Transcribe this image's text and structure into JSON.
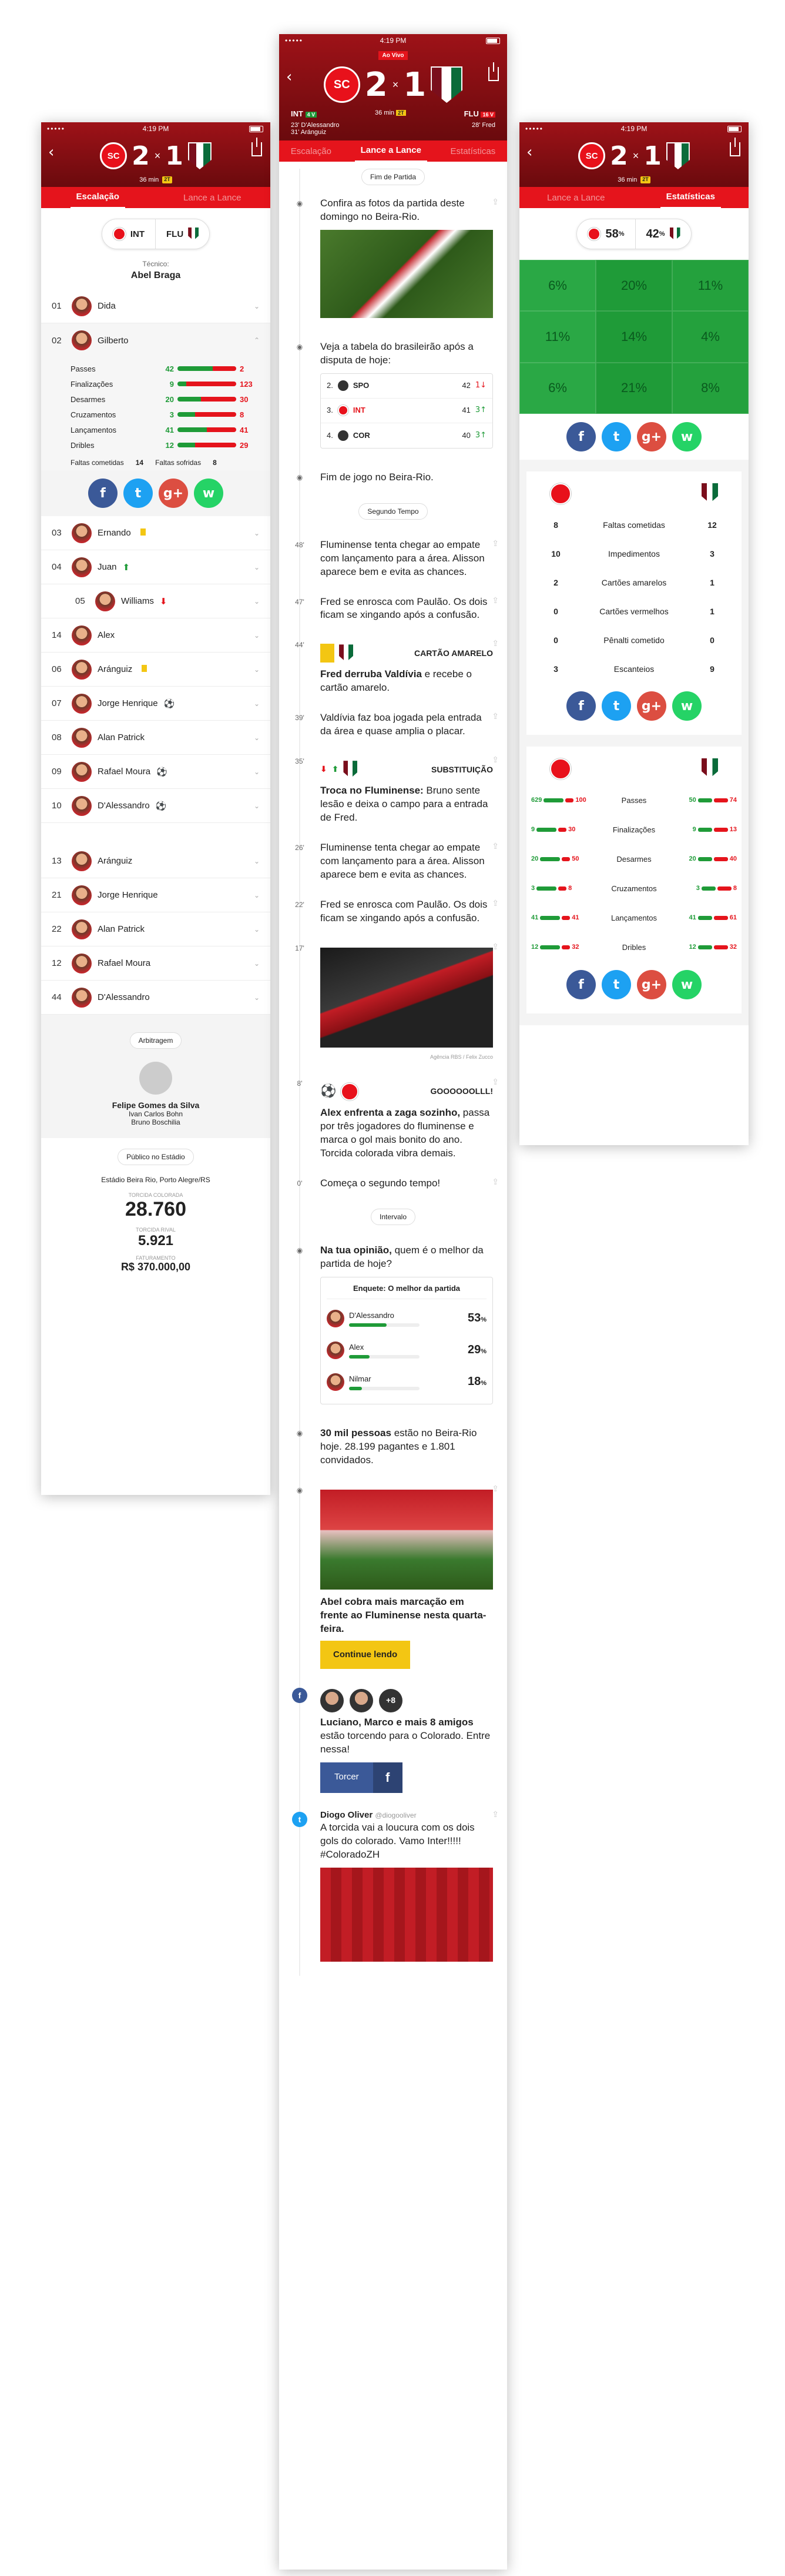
{
  "status_time": "4:19 PM",
  "carrier": "•••••",
  "score": {
    "home_abbr": "INT",
    "away_abbr": "FLU",
    "home": "2",
    "away": "1",
    "sep": "×",
    "minute": "36 min",
    "period": "2T",
    "home_badge": "4 V",
    "away_badge": "16 V",
    "live": "Ao Vivo",
    "home_goals": [
      "23' D'Alessandro",
      "31' Aránguiz"
    ],
    "away_goals": [
      "28' Fred"
    ]
  },
  "tabs": {
    "a": [
      "Escalação",
      "Lance a Lance"
    ],
    "b": [
      "Escalação",
      "Lance a Lance",
      "Estatísticas"
    ],
    "c": [
      "Lance a Lance",
      "Estatísticas"
    ]
  },
  "lineup": {
    "coach_label": "Técnico:",
    "coach": "Abel Braga",
    "team_home": "INT",
    "team_away": "FLU",
    "players": [
      {
        "n": "01",
        "name": "Dida"
      },
      {
        "n": "02",
        "name": "Gilberto"
      }
    ],
    "stats": [
      {
        "l": "Passes",
        "g": "42",
        "r": "2",
        "gp": 0.6,
        "rp": 0.4
      },
      {
        "l": "Finalizações",
        "g": "9",
        "r": "123",
        "gp": 0.15,
        "rp": 0.85
      },
      {
        "l": "Desarmes",
        "g": "20",
        "r": "30",
        "gp": 0.4,
        "rp": 0.6
      },
      {
        "l": "Cruzamentos",
        "g": "3",
        "r": "8",
        "gp": 0.3,
        "rp": 0.7
      },
      {
        "l": "Lançamentos",
        "g": "41",
        "r": "41",
        "gp": 0.5,
        "rp": 0.5
      },
      {
        "l": "Dribles",
        "g": "12",
        "r": "29",
        "gp": 0.3,
        "rp": 0.7
      }
    ],
    "faltas_cometidas": "Faltas cometidas",
    "faltas_c_val": "14",
    "faltas_sofridas": "Faltas sofridas",
    "faltas_s_val": "8",
    "players2": [
      {
        "n": "03",
        "name": "Ernando",
        "mark": "yellow"
      },
      {
        "n": "04",
        "name": "Juan",
        "mark": "up"
      },
      {
        "n": "05",
        "name": "Williams",
        "mark": "down"
      },
      {
        "n": "14",
        "name": "Alex",
        "mark": ""
      },
      {
        "n": "06",
        "name": "Aránguiz",
        "mark": "yellow"
      },
      {
        "n": "07",
        "name": "Jorge Henrique",
        "mark": "ball"
      },
      {
        "n": "08",
        "name": "Alan Patrick",
        "mark": ""
      },
      {
        "n": "09",
        "name": "Rafael Moura",
        "mark": "ball"
      },
      {
        "n": "10",
        "name": "D'Alessandro",
        "mark": "ball"
      }
    ],
    "bench": [
      {
        "n": "13",
        "name": "Aránguiz"
      },
      {
        "n": "21",
        "name": "Jorge Henrique"
      },
      {
        "n": "22",
        "name": "Alan Patrick"
      },
      {
        "n": "12",
        "name": "Rafael Moura"
      },
      {
        "n": "44",
        "name": "D'Alessandro"
      }
    ],
    "arb_label": "Arbitragem",
    "referee": "Felipe Gomes da Silva",
    "assist1": "Ivan Carlos Bohn",
    "assist2": "Bruno Boschilia",
    "public_label": "Público no Estádio",
    "stadium": "Estádio Beira Rio, Porto Alegre/RS",
    "torcida_colorada_label": "TORCIDA COLORADA",
    "torcida_colorada": "28.760",
    "torcida_rival_label": "TORCIDA RIVAL",
    "torcida_rival": "5.921",
    "faturamento_label": "FATURAMENTO",
    "faturamento": "R$ 370.000,00"
  },
  "feed": {
    "sec_fim": "Fim de Partida",
    "e1": "Confira as fotos da partida deste domingo no Beira-Rio.",
    "e2": "Veja a tabela do brasileirão após a disputa de hoje:",
    "table": [
      {
        "pos": "2.",
        "team": "SPO",
        "pts": "42",
        "chg": "1",
        "dir": "down"
      },
      {
        "pos": "3.",
        "team": "INT",
        "pts": "41",
        "chg": "3",
        "dir": "up"
      },
      {
        "pos": "4.",
        "team": "COR",
        "pts": "40",
        "chg": "3",
        "dir": "up"
      }
    ],
    "e3": "Fim de jogo no Beira-Rio.",
    "sec_seg": "Segundo Tempo",
    "m48": "48'",
    "e48": "Fluminense tenta chegar ao empate com lançamento para a área. Alisson aparece bem e evita as chances.",
    "m47": "47'",
    "e47": "Fred se enrosca com Paulão. Os dois ficam se xingando após a confusão.",
    "m44": "44'",
    "cartao": "CARTÃO AMARELO",
    "e44b": "Fred derruba Valdívia",
    "e44": " e recebe o cartão amarelo.",
    "m39": "39'",
    "e39": "Valdívia faz boa jogada pela entrada da área e quase amplia o placar.",
    "m35": "35'",
    "subst": "SUBSTITUIÇÃO",
    "e35b": "Troca no Fluminense:",
    "e35": " Bruno sente lesão e deixa o campo para a entrada de Fred.",
    "m26": "26'",
    "e26": "Fluminense tenta chegar ao empate com lançamento para a área. Alisson aparece bem e evita as chances.",
    "m22": "22'",
    "e22": "Fred se enrosca com Paulão. Os dois ficam se xingando após a confusão.",
    "m17": "17'",
    "credit": "Agência RBS / Felix Zucco",
    "m8": "8'",
    "gol": "GOOOOOOLLL!",
    "e8b": "Alex enfrenta a zaga sozinho,",
    "e8": " passa por três jogadores do fluminense e marca o gol mais bonito do ano. Torcida colorada vibra demais.",
    "m0": "0'",
    "e0": "Começa o segundo tempo!",
    "sec_int": "Intervalo",
    "e_op_b": "Na tua opinião,",
    "e_op": " quem é o melhor da partida de hoje?",
    "enquete": "Enquete: O melhor da partida",
    "poll": [
      {
        "name": "D'Alessandro",
        "pct": "53",
        "val": 0.53
      },
      {
        "name": "Alex",
        "pct": "29",
        "val": 0.29
      },
      {
        "name": "Nilmar",
        "pct": "18",
        "val": 0.18
      }
    ],
    "pct_sign": "%",
    "e_pub_b": "30 mil pessoas",
    "e_pub": " estão no Beira-Rio hoje. 28.199 pagantes e 1.801 convidados.",
    "e_abel": "Abel cobra mais marcação em frente ao Fluminense nesta quarta-feira.",
    "continue": "Continue lendo",
    "plus": "+8",
    "e_fb_b": "Luciano, Marco e mais 8 amigos",
    "e_fb": " estão torcendo para o Colorado. Entre nessa!",
    "torcer": "Torcer",
    "tw_name": "Diogo Oliver",
    "tw_handle": "@diogooliver",
    "tw_text": "A torcida vai a loucura com os dois gols do colorado. Vamo Inter!!!!! #ColoradoZH"
  },
  "stats": {
    "poss_home": "58",
    "poss_away": "42",
    "pct": "%",
    "heat": [
      "6%",
      "20%",
      "11%",
      "11%",
      "14%",
      "4%",
      "6%",
      "21%",
      "8%"
    ],
    "list1": [
      {
        "a": "8",
        "m": "Faltas cometidas",
        "b": "12"
      },
      {
        "a": "10",
        "m": "Impedimentos",
        "b": "3"
      },
      {
        "a": "2",
        "m": "Cartões amarelos",
        "b": "1"
      },
      {
        "a": "0",
        "m": "Cartões vermelhos",
        "b": "1"
      },
      {
        "a": "0",
        "m": "Pênalti cometido",
        "b": "0"
      },
      {
        "a": "3",
        "m": "Escanteios",
        "b": "9"
      }
    ],
    "list2": [
      {
        "m": "Passes",
        "a": "629",
        "a2": "100",
        "b": "50",
        "b2": "74"
      },
      {
        "m": "Finalizações",
        "a": "9",
        "a2": "30",
        "b": "9",
        "b2": "13"
      },
      {
        "m": "Desarmes",
        "a": "20",
        "a2": "50",
        "b": "20",
        "b2": "40"
      },
      {
        "m": "Cruzamentos",
        "a": "3",
        "a2": "8",
        "b": "3",
        "b2": "8"
      },
      {
        "m": "Lançamentos",
        "a": "41",
        "a2": "41",
        "b": "41",
        "b2": "61"
      },
      {
        "m": "Dribles",
        "a": "12",
        "a2": "32",
        "b": "12",
        "b2": "32"
      }
    ]
  },
  "social": {
    "fb": "f",
    "tw": "t",
    "gp": "g+",
    "wa": "w"
  }
}
